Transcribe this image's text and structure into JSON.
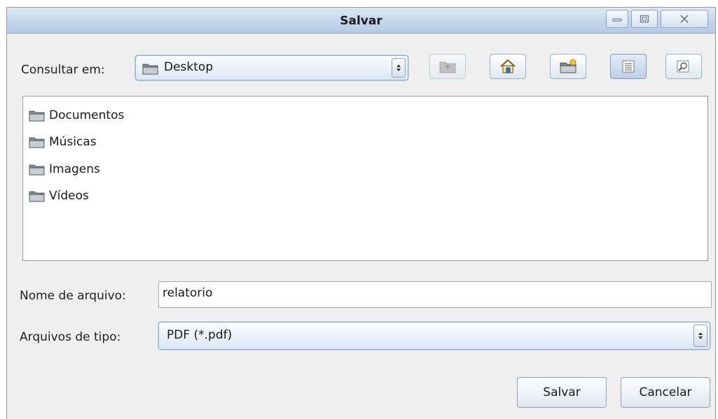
{
  "window": {
    "title": "Salvar",
    "controls": [
      "minimize-icon",
      "maximize-icon",
      "close-icon"
    ]
  },
  "lookin": {
    "label": "Consultar em:",
    "value": "Desktop"
  },
  "toolbar": {
    "buttons": [
      {
        "name": "up-one-level",
        "icon": "folder-up-icon",
        "state": "disabled"
      },
      {
        "name": "home",
        "icon": "home-icon"
      },
      {
        "name": "new-folder",
        "icon": "new-folder-icon"
      },
      {
        "name": "list-view",
        "icon": "list-view-icon",
        "state": "active"
      },
      {
        "name": "details-view",
        "icon": "details-view-icon"
      }
    ]
  },
  "files": [
    {
      "name": "Documentos",
      "icon": "folder-icon"
    },
    {
      "name": "Músicas",
      "icon": "folder-icon"
    },
    {
      "name": "Imagens",
      "icon": "folder-icon"
    },
    {
      "name": "Vídeos",
      "icon": "folder-icon"
    }
  ],
  "filename": {
    "label": "Nome de arquivo:",
    "value": "relatorio"
  },
  "filetype": {
    "label": "Arquivos de tipo:",
    "value": "PDF (*.pdf)"
  },
  "buttons": {
    "save": "Salvar",
    "cancel": "Cancelar"
  },
  "colors": {
    "titlebar": "#c4d6ec",
    "accent_border": "#8fa9c9",
    "window_bg": "#efefef"
  }
}
